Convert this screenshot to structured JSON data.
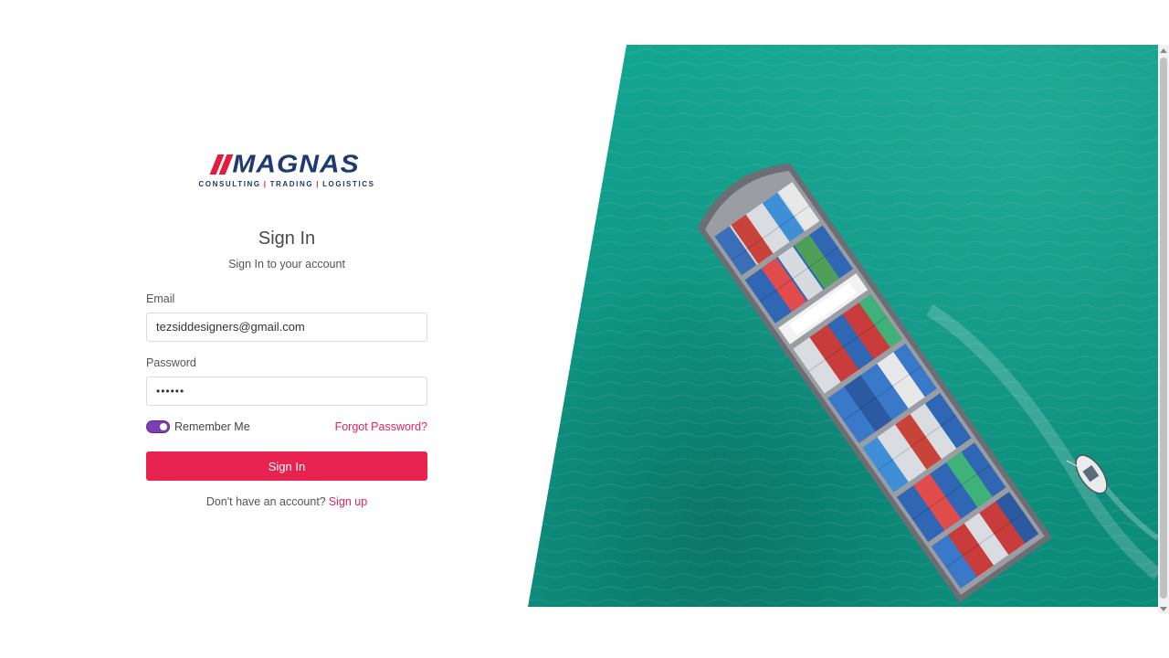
{
  "brand": {
    "name": "MAGNAS",
    "tagline_parts": [
      "CONSULTING",
      "TRADING",
      "LOGISTICS"
    ],
    "colors": {
      "primary": "#1e3a6e",
      "accent": "#e31c3d"
    }
  },
  "login": {
    "title": "Sign In",
    "subtitle": "Sign In to your account",
    "email_label": "Email",
    "email_value": "tezsiddesigners@gmail.com",
    "password_label": "Password",
    "password_value": "••••••",
    "remember_label": "Remember Me",
    "remember_checked": true,
    "forgot_label": "Forgot Password?",
    "submit_label": "Sign In",
    "signup_prompt": "Don't have an account?",
    "signup_link": "Sign up"
  },
  "colors": {
    "button": "#e8234f",
    "link": "#e0245e",
    "toggle": "#7b3fb3",
    "sea": "#0f9684"
  },
  "hero": {
    "image_icon": "container-ship-image"
  }
}
